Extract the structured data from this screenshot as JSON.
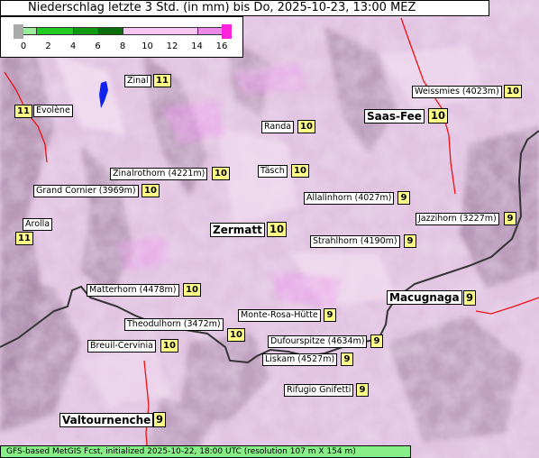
{
  "title": "Niederschlag letzte 3 Std. (in mm) bis Do, 2025-10-23, 13:00 MEZ",
  "legend": {
    "ticks": [
      "0",
      "2",
      "4",
      "6",
      "8",
      "10",
      "12",
      "14",
      "16"
    ],
    "segments": [
      {
        "from": 0,
        "to": 1,
        "color": "#9aee9a"
      },
      {
        "from": 1,
        "to": 4,
        "color": "#22cc22"
      },
      {
        "from": 4,
        "to": 6,
        "color": "#119911"
      },
      {
        "from": 6,
        "to": 8,
        "color": "#0a6e0a"
      },
      {
        "from": 8,
        "to": 14,
        "color": "#f7c6f2"
      },
      {
        "from": 14,
        "to": 16,
        "color": "#ee88e8"
      }
    ],
    "under_color": "#aaaaaa",
    "over_color": "#ff22dd"
  },
  "locations": [
    {
      "name": "Zinal",
      "value": "11"
    },
    {
      "name": "Evolène",
      "value": "11"
    },
    {
      "name": "Weissmies (4023m)",
      "value": "10"
    },
    {
      "name": "Saas-Fee",
      "value": "10"
    },
    {
      "name": "Randa",
      "value": "10"
    },
    {
      "name": "Täsch",
      "value": "10"
    },
    {
      "name": "Zinalrothorn (4221m)",
      "value": "10"
    },
    {
      "name": "Grand Cornier (3969m)",
      "value": "10"
    },
    {
      "name": "Allalinhorn (4027m)",
      "value": "9"
    },
    {
      "name": "Jazzihorn (3227m)",
      "value": "9"
    },
    {
      "name": "Arolla",
      "value": "11"
    },
    {
      "name": "Zermatt",
      "value": "10"
    },
    {
      "name": "Strahlhorn (4190m)",
      "value": "9"
    },
    {
      "name": "Matterhorn (4478m)",
      "value": "10"
    },
    {
      "name": "Macugnaga",
      "value": "9"
    },
    {
      "name": "Monte-Rosa-Hütte",
      "value": "9"
    },
    {
      "name": "Theodulhorn (3472m)",
      "value": "10"
    },
    {
      "name": "Dufourspitze (4634m)",
      "value": "9"
    },
    {
      "name": "Breuil-Cervinia",
      "value": "10"
    },
    {
      "name": "Liskam (4527m)",
      "value": "9"
    },
    {
      "name": "Rifugio Gnifetti",
      "value": "9"
    },
    {
      "name": "Valtournenche",
      "value": "9"
    }
  ],
  "footer": "GFS-based MetGIS Fcst, initialized 2025-10-22, 18:00 UTC  (resolution 107 m X 154 m)",
  "colors": {
    "terrain_base": "#e2c3e2",
    "terrain_shadow": "#a888a8",
    "terrain_light": "#f6e2f4",
    "precip_high": "#ee9aee",
    "lake": "#1122ee",
    "border": "#333333",
    "canton": "#ee1111",
    "label_value": "#ffff88",
    "footer_bg": "#88ee88"
  }
}
